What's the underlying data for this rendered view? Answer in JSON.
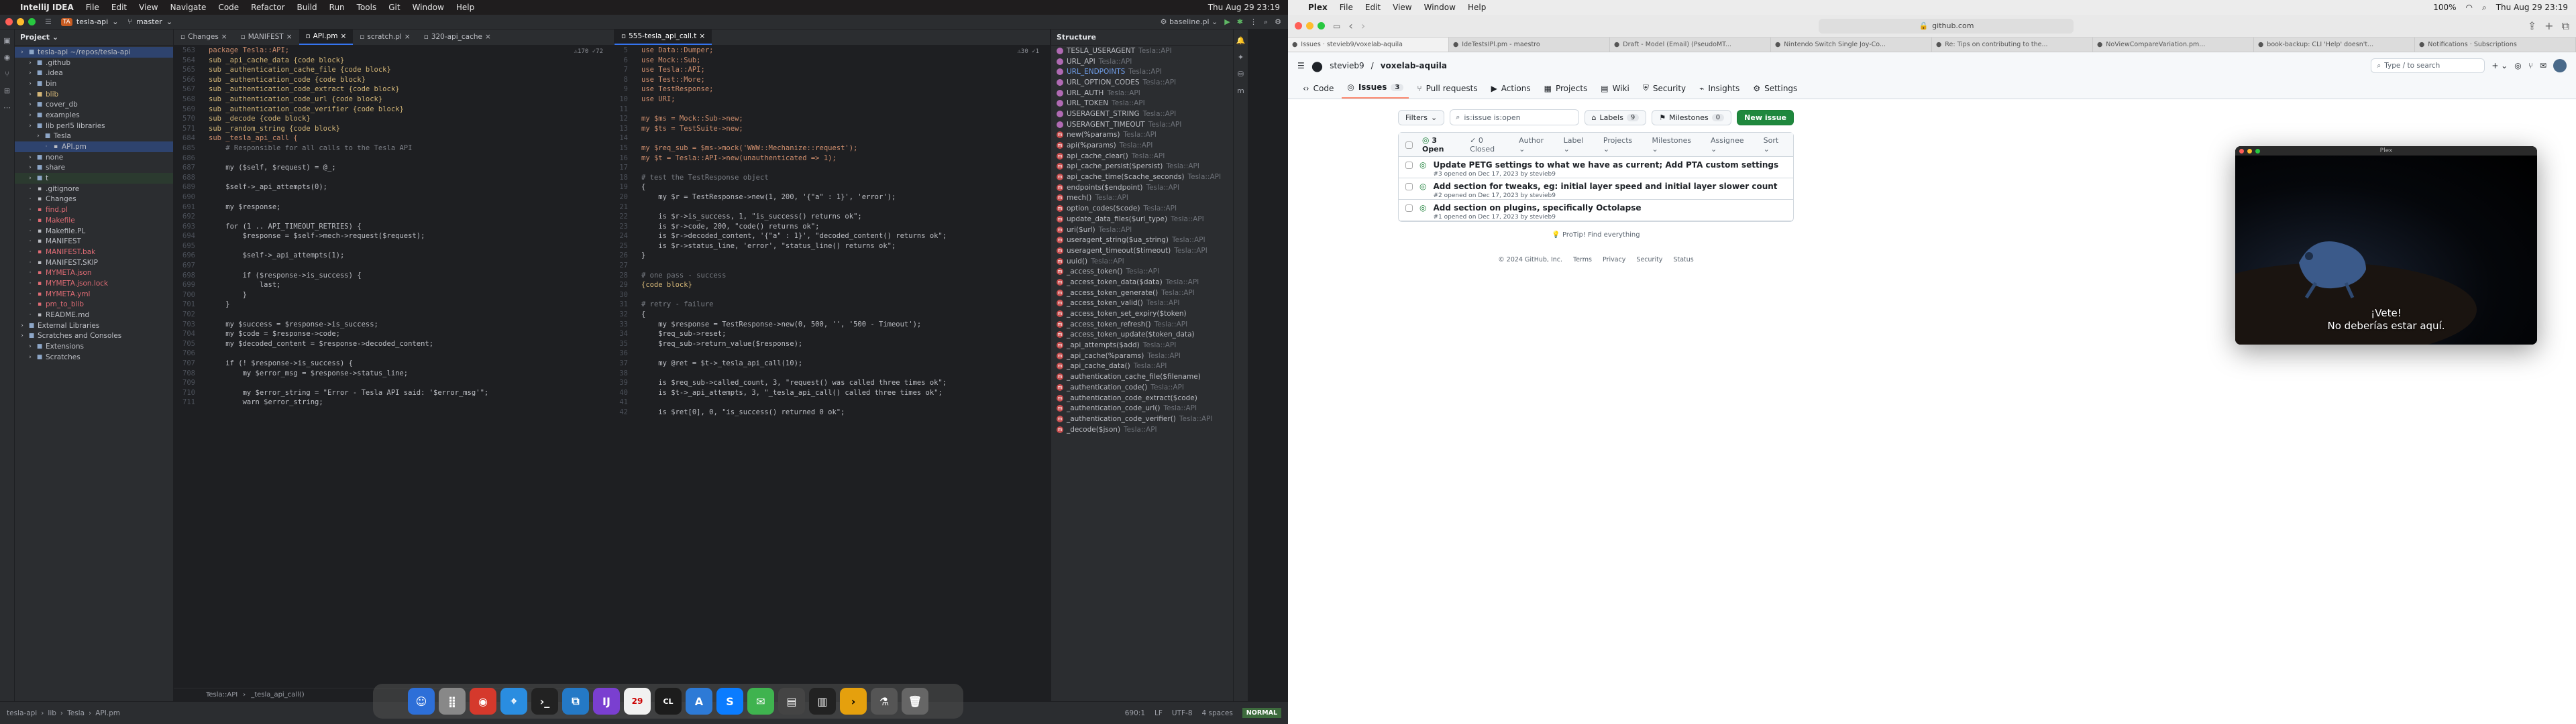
{
  "left_menubar": {
    "app": "IntelliJ IDEA",
    "menus": [
      "File",
      "Edit",
      "View",
      "Navigate",
      "Code",
      "Refactor",
      "Build",
      "Run",
      "Tools",
      "Git",
      "Window",
      "Help"
    ],
    "clock": "Thu Aug 29 23:19"
  },
  "right_menubar": {
    "app": "Plex",
    "menus": [
      "File",
      "Edit",
      "View",
      "Window",
      "Help"
    ],
    "battery": "100%",
    "clock": "Thu Aug 29 23:19"
  },
  "ide": {
    "project_badge": "TA",
    "project": "tesla-api",
    "branch": "master",
    "run_config": "baseline.pl",
    "pane_title": "Project",
    "tree": [
      {
        "t": "tesla-api ~/repos/tesla-api",
        "lvl": 0,
        "cls": "folder",
        "sel": true
      },
      {
        "t": ".github",
        "lvl": 1,
        "cls": "folder"
      },
      {
        "t": ".idea",
        "lvl": 1,
        "cls": "folder"
      },
      {
        "t": "bin",
        "lvl": 1,
        "cls": "folder"
      },
      {
        "t": "blib",
        "lvl": 1,
        "cls": "folder yel"
      },
      {
        "t": "cover_db",
        "lvl": 1,
        "cls": "folder"
      },
      {
        "t": "examples",
        "lvl": 1,
        "cls": "folder"
      },
      {
        "t": "lib  perl5 libraries",
        "lvl": 1,
        "cls": "folder"
      },
      {
        "t": "Tesla",
        "lvl": 2,
        "cls": "folder"
      },
      {
        "t": "API.pm",
        "lvl": 3,
        "cls": "",
        "sel": true
      },
      {
        "t": "none",
        "lvl": 1,
        "cls": "folder"
      },
      {
        "t": "share",
        "lvl": 1,
        "cls": "folder"
      },
      {
        "t": "t",
        "lvl": 1,
        "cls": "folder",
        "hl": true
      },
      {
        "t": ".gitignore",
        "lvl": 1,
        "cls": ""
      },
      {
        "t": "Changes",
        "lvl": 1,
        "cls": ""
      },
      {
        "t": "find.pl",
        "lvl": 1,
        "cls": "red"
      },
      {
        "t": "Makefile",
        "lvl": 1,
        "cls": "red"
      },
      {
        "t": "Makefile.PL",
        "lvl": 1,
        "cls": ""
      },
      {
        "t": "MANIFEST",
        "lvl": 1,
        "cls": ""
      },
      {
        "t": "MANIFEST.bak",
        "lvl": 1,
        "cls": "red"
      },
      {
        "t": "MANIFEST.SKIP",
        "lvl": 1,
        "cls": ""
      },
      {
        "t": "MYMETA.json",
        "lvl": 1,
        "cls": "red"
      },
      {
        "t": "MYMETA.json.lock",
        "lvl": 1,
        "cls": "red"
      },
      {
        "t": "MYMETA.yml",
        "lvl": 1,
        "cls": "red"
      },
      {
        "t": "pm_to_blib",
        "lvl": 1,
        "cls": "red"
      },
      {
        "t": "README.md",
        "lvl": 1,
        "cls": ""
      },
      {
        "t": "External Libraries",
        "lvl": 0,
        "cls": "folder"
      },
      {
        "t": "Scratches and Consoles",
        "lvl": 0,
        "cls": "folder"
      },
      {
        "t": "Extensions",
        "lvl": 1,
        "cls": "folder"
      },
      {
        "t": "Scratches",
        "lvl": 1,
        "cls": "folder"
      }
    ],
    "tabs_left": [
      "Changes",
      "MANIFEST",
      "API.pm",
      "scratch.pl",
      "320-api_cache"
    ],
    "tabs_right": [
      "555-tesla_api_call.t"
    ],
    "hint_left": "⚠170 ✓72",
    "hint_right": "⚠30 ✓1",
    "code_left": [
      [
        "563",
        "package Tesla::API;"
      ],
      [
        "564",
        "sub _api_cache_data {code block}"
      ],
      [
        "565",
        "sub _authentication_cache_file {code block}"
      ],
      [
        "566",
        "sub _authentication_code {code block}"
      ],
      [
        "567",
        "sub _authentication_code_extract {code block}"
      ],
      [
        "568",
        "sub _authentication_code_url {code block}"
      ],
      [
        "569",
        "sub _authentication_code_verifier {code block}"
      ],
      [
        "570",
        "sub _decode {code block}"
      ],
      [
        "571",
        "sub _random_string {code block}"
      ],
      [
        "684",
        "sub _tesla_api_call {"
      ],
      [
        "685",
        "    # Responsible for all calls to the Tesla API"
      ],
      [
        "686",
        ""
      ],
      [
        "687",
        "    my ($self, $request) = @_;"
      ],
      [
        "688",
        ""
      ],
      [
        "689",
        "    $self->_api_attempts(0);"
      ],
      [
        "690",
        ""
      ],
      [
        "691",
        "    my $response;"
      ],
      [
        "692",
        ""
      ],
      [
        "693",
        "    for (1 .. API_TIMEOUT_RETRIES) {"
      ],
      [
        "694",
        "        $response = $self->mech->request($request);"
      ],
      [
        "695",
        ""
      ],
      [
        "696",
        "        $self->_api_attempts(1);"
      ],
      [
        "697",
        ""
      ],
      [
        "698",
        "        if ($response->is_success) {"
      ],
      [
        "699",
        "            last;"
      ],
      [
        "700",
        "        }"
      ],
      [
        "701",
        "    }"
      ],
      [
        "702",
        ""
      ],
      [
        "703",
        "    my $success = $response->is_success;"
      ],
      [
        "704",
        "    my $code = $response->code;"
      ],
      [
        "705",
        "    my $decoded_content = $response->decoded_content;"
      ],
      [
        "706",
        ""
      ],
      [
        "707",
        "    if (! $response->is_success) {"
      ],
      [
        "708",
        "        my $error_msg = $response->status_line;"
      ],
      [
        "709",
        ""
      ],
      [
        "710",
        "        my $error_string = \"Error - Tesla API said: '$error_msg'\";"
      ],
      [
        "711",
        "        warn $error_string;"
      ]
    ],
    "code_right": [
      [
        "5",
        "use Data::Dumper;"
      ],
      [
        "6",
        "use Mock::Sub;"
      ],
      [
        "7",
        "use Tesla::API;"
      ],
      [
        "8",
        "use Test::More;"
      ],
      [
        "9",
        "use TestResponse;"
      ],
      [
        "10",
        "use URI;"
      ],
      [
        "11",
        ""
      ],
      [
        "12",
        "my $ms = Mock::Sub->new;"
      ],
      [
        "13",
        "my $ts = TestSuite->new;"
      ],
      [
        "14",
        ""
      ],
      [
        "15",
        "my $req_sub = $ms->mock('WWW::Mechanize::request');"
      ],
      [
        "16",
        "my $t = Tesla::API->new(unauthenticated => 1);"
      ],
      [
        "17",
        ""
      ],
      [
        "18",
        "# test the TestResponse object"
      ],
      [
        "19",
        "{"
      ],
      [
        "20",
        "    my $r = TestResponse->new(1, 200, '{\"a\" : 1}', 'error');"
      ],
      [
        "21",
        ""
      ],
      [
        "22",
        "    is $r->is_success, 1, \"is_success() returns ok\";"
      ],
      [
        "23",
        "    is $r->code, 200, \"code() returns ok\";"
      ],
      [
        "24",
        "    is $r->decoded_content, '{\"a\" : 1}', \"decoded_content() returns ok\";"
      ],
      [
        "25",
        "    is $r->status_line, 'error', \"status_line() returns ok\";"
      ],
      [
        "26",
        "}"
      ],
      [
        "27",
        ""
      ],
      [
        "28",
        "# one pass - success"
      ],
      [
        "29",
        "{code block}"
      ],
      [
        "30",
        ""
      ],
      [
        "31",
        "# retry - failure"
      ],
      [
        "32",
        "{"
      ],
      [
        "33",
        "    my $response = TestResponse->new(0, 500, '', '500 - Timeout');"
      ],
      [
        "34",
        "    $req_sub->reset;"
      ],
      [
        "35",
        "    $req_sub->return_value($response);"
      ],
      [
        "36",
        ""
      ],
      [
        "37",
        "    my @ret = $t->_tesla_api_call(10);"
      ],
      [
        "38",
        ""
      ],
      [
        "39",
        "    is $req_sub->called_count, 3, \"request() was called three times ok\";"
      ],
      [
        "40",
        "    is $t->_api_attempts, 3, \"_tesla_api_call() called three times ok\";"
      ],
      [
        "41",
        ""
      ],
      [
        "42",
        "    is $ret[0], 0, \"is_success() returned 0 ok\";"
      ]
    ],
    "structure_title": "Structure",
    "structure": [
      {
        "k": "f",
        "n": "TESLA_USERAGENT",
        "c": "Tesla::API"
      },
      {
        "k": "f",
        "n": "URL_API",
        "c": "Tesla::API"
      },
      {
        "k": "f",
        "n": "URL_ENDPOINTS",
        "c": "Tesla::API",
        "blue": true
      },
      {
        "k": "f",
        "n": "URL_OPTION_CODES",
        "c": "Tesla::API"
      },
      {
        "k": "f",
        "n": "URL_AUTH",
        "c": "Tesla::API"
      },
      {
        "k": "f",
        "n": "URL_TOKEN",
        "c": "Tesla::API"
      },
      {
        "k": "f",
        "n": "USERAGENT_STRING",
        "c": "Tesla::API"
      },
      {
        "k": "f",
        "n": "USERAGENT_TIMEOUT",
        "c": "Tesla::API"
      },
      {
        "k": "m",
        "n": "new(%params)",
        "c": "Tesla::API"
      },
      {
        "k": "m",
        "n": "api(%params)",
        "c": "Tesla::API"
      },
      {
        "k": "m",
        "n": "api_cache_clear()",
        "c": "Tesla::API"
      },
      {
        "k": "m",
        "n": "api_cache_persist($persist)",
        "c": "Tesla::API"
      },
      {
        "k": "m",
        "n": "api_cache_time($cache_seconds)",
        "c": "Tesla::API"
      },
      {
        "k": "m",
        "n": "endpoints($endpoint)",
        "c": "Tesla::API"
      },
      {
        "k": "m",
        "n": "mech()",
        "c": "Tesla::API"
      },
      {
        "k": "m",
        "n": "option_codes($code)",
        "c": "Tesla::API"
      },
      {
        "k": "m",
        "n": "update_data_files($url_type)",
        "c": "Tesla::API"
      },
      {
        "k": "m",
        "n": "uri($url)",
        "c": "Tesla::API"
      },
      {
        "k": "m",
        "n": "useragent_string($ua_string)",
        "c": "Tesla::API"
      },
      {
        "k": "m",
        "n": "useragent_timeout($timeout)",
        "c": "Tesla::API"
      },
      {
        "k": "m",
        "n": "uuid()",
        "c": "Tesla::API"
      },
      {
        "k": "m",
        "n": "_access_token()",
        "c": "Tesla::API"
      },
      {
        "k": "m",
        "n": "_access_token_data($data)",
        "c": "Tesla::API"
      },
      {
        "k": "m",
        "n": "_access_token_generate()",
        "c": "Tesla::API"
      },
      {
        "k": "m",
        "n": "_access_token_valid()",
        "c": "Tesla::API"
      },
      {
        "k": "m",
        "n": "_access_token_set_expiry($token)",
        "c": ""
      },
      {
        "k": "m",
        "n": "_access_token_refresh()",
        "c": "Tesla::API"
      },
      {
        "k": "m",
        "n": "_access_token_update($token_data)",
        "c": ""
      },
      {
        "k": "m",
        "n": "_api_attempts($add)",
        "c": "Tesla::API"
      },
      {
        "k": "m",
        "n": "_api_cache(%params)",
        "c": "Tesla::API"
      },
      {
        "k": "m",
        "n": "_api_cache_data()",
        "c": "Tesla::API"
      },
      {
        "k": "m",
        "n": "_authentication_cache_file($filename)",
        "c": ""
      },
      {
        "k": "m",
        "n": "_authentication_code()",
        "c": "Tesla::API"
      },
      {
        "k": "m",
        "n": "_authentication_code_extract($code)",
        "c": ""
      },
      {
        "k": "m",
        "n": "_authentication_code_url()",
        "c": "Tesla::API"
      },
      {
        "k": "m",
        "n": "_authentication_code_verifier()",
        "c": "Tesla::API"
      },
      {
        "k": "m",
        "n": "_decode($json)",
        "c": "Tesla::API"
      }
    ],
    "breadcrumb_code": [
      "Tesla::API",
      "_tesla_api_call()"
    ],
    "status_path": [
      "tesla-api",
      "lib",
      "Tesla",
      "API.pm"
    ],
    "status_right": [
      "690:1",
      "LF",
      "UTF-8",
      "4 spaces"
    ],
    "mode": "NORMAL"
  },
  "browser": {
    "url": "github.com",
    "tabs": [
      "Issues · stevieb9/voxelab-aquila",
      "IdeTestsIPl.pm - maestro",
      "Draft - Model (Email) (PseudoMT...",
      "Nintendo Switch Single Joy-Co...",
      "Re: Tips on contributing to the...",
      "NoViewCompareVariation.pm...",
      "book-backup: CLI 'Help' doesn't...",
      "Notifications · Subscriptions"
    ],
    "user": "stevieb9",
    "repo": "voxelab-aquila",
    "search_placeholder": "Type / to search",
    "repo_tabs": [
      {
        "label": "Code",
        "n": ""
      },
      {
        "label": "Issues",
        "n": "3",
        "act": true
      },
      {
        "label": "Pull requests",
        "n": ""
      },
      {
        "label": "Actions",
        "n": ""
      },
      {
        "label": "Projects",
        "n": ""
      },
      {
        "label": "Wiki",
        "n": ""
      },
      {
        "label": "Security",
        "n": ""
      },
      {
        "label": "Insights",
        "n": ""
      },
      {
        "label": "Settings",
        "n": ""
      }
    ],
    "filters_label": "Filters",
    "search_value": "is:issue is:open",
    "labels": "Labels",
    "labels_n": "9",
    "milestones": "Milestones",
    "milestones_n": "0",
    "new_issue": "New issue",
    "open_label": "3 Open",
    "closed_label": "0 Closed",
    "col_filters": [
      "Author",
      "Label",
      "Projects",
      "Milestones",
      "Assignee",
      "Sort"
    ],
    "issues": [
      {
        "title": "Update PETG settings to what we have as current; Add PTA custom settings",
        "meta": "#3 opened on Dec 17, 2023 by stevieb9"
      },
      {
        "title": "Add section for tweaks, eg: initial layer speed and initial layer slower count",
        "meta": "#2 opened on Dec 17, 2023 by stevieb9"
      },
      {
        "title": "Add section on plugins, specifically Octolapse",
        "meta": "#1 opened on Dec 17, 2023 by stevieb9"
      }
    ],
    "protip": "ProTip! Find everything",
    "footer": [
      "© 2024 GitHub, Inc.",
      "Terms",
      "Privacy",
      "Security",
      "Status"
    ]
  },
  "plex": {
    "title": "Plex",
    "subtitle_line1": "¡Vete!",
    "subtitle_line2": "No deberías estar aquí."
  }
}
